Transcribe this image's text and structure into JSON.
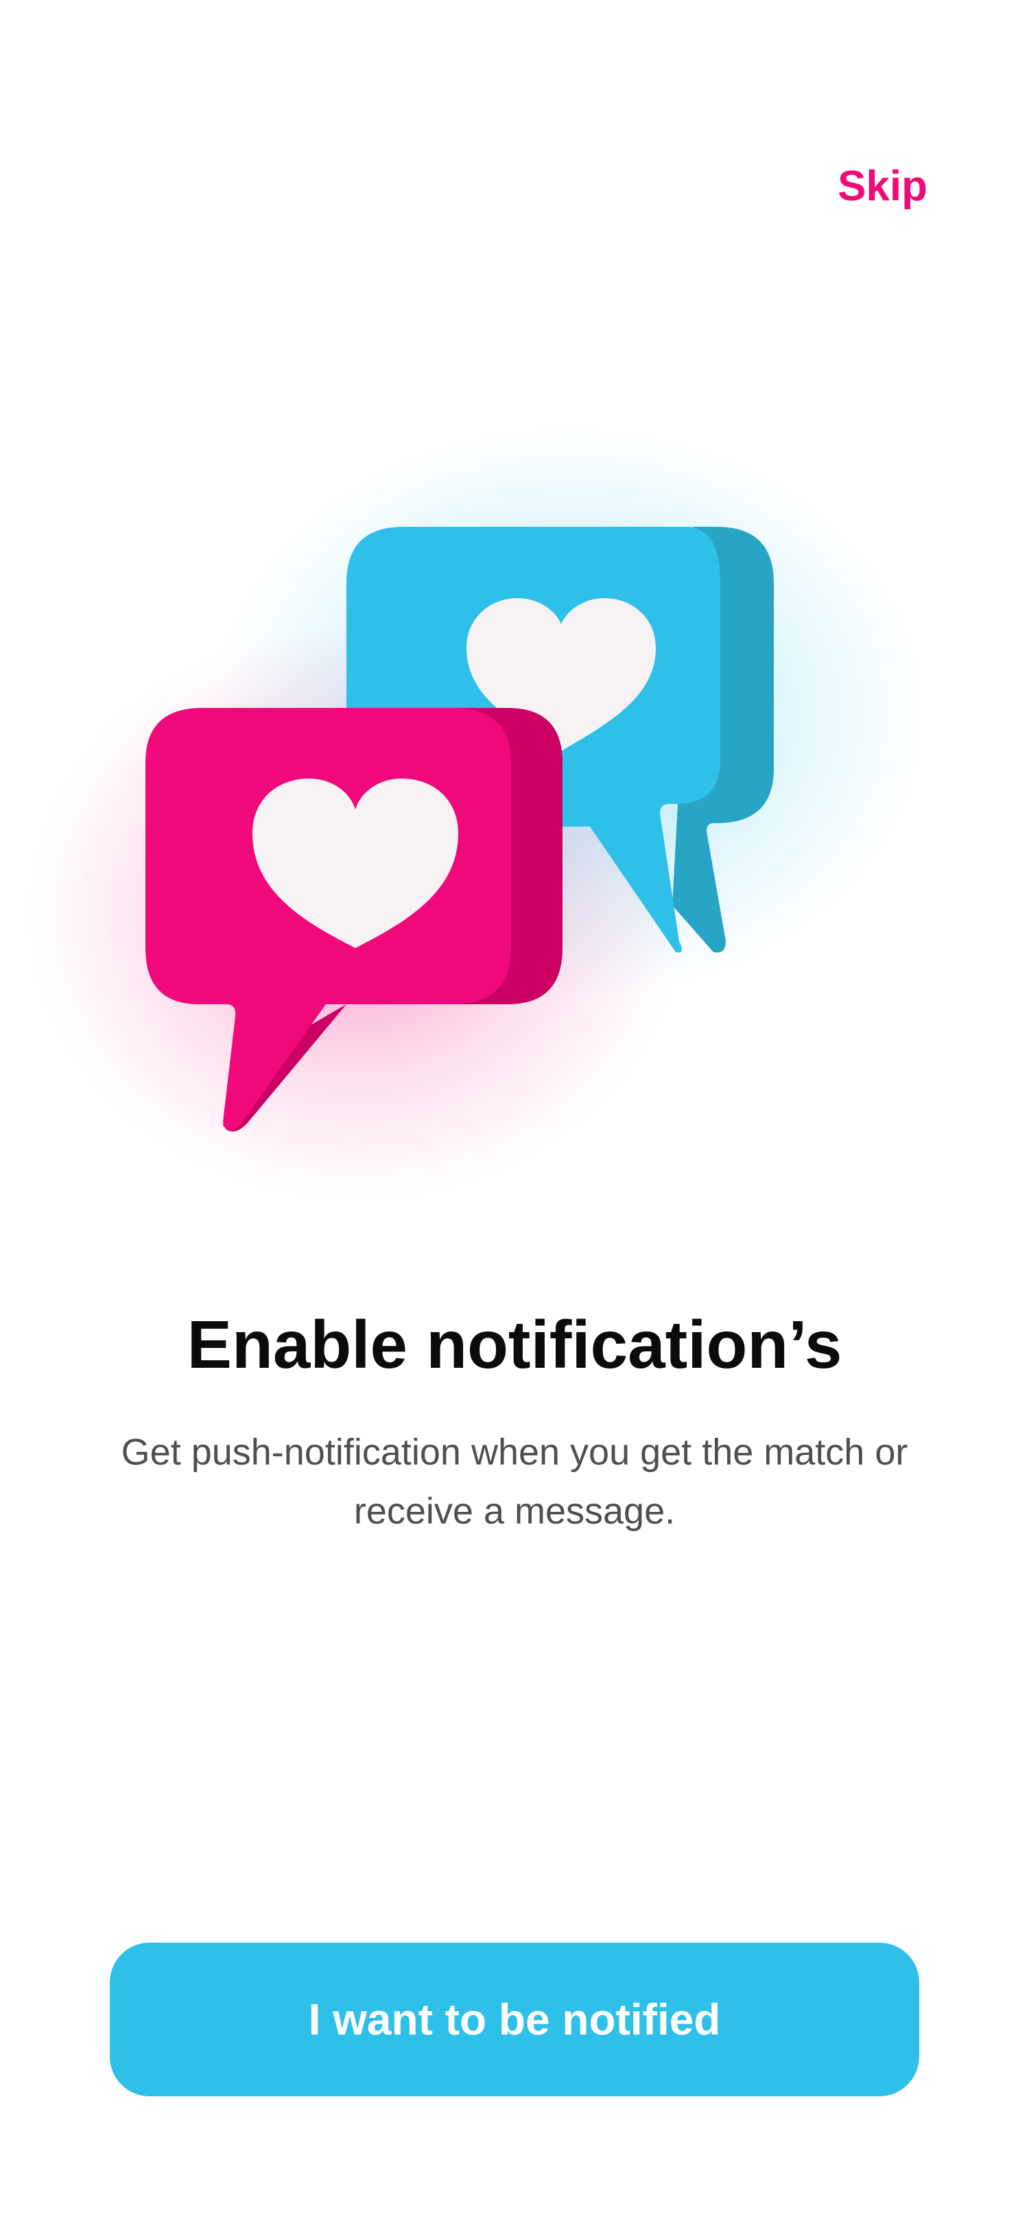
{
  "header": {
    "skip_label": "Skip"
  },
  "illustration": {
    "icon": "chat-bubbles-heart-icon",
    "colors": {
      "pink": "#f0097a",
      "pink_shade": "#cc0064",
      "blue": "#2ec0e9",
      "blue_shade": "#28a4c4",
      "heart": "#f7f3f4"
    }
  },
  "main": {
    "title": "Enable notification’s",
    "subtitle": "Get push-notification when you get the match or receive a message."
  },
  "footer": {
    "cta_label": "I want to be notified",
    "cta_color": "#2ec0e9"
  },
  "colors": {
    "accent": "#ef0a78",
    "background": "#ffffff",
    "title": "#0b0b0b",
    "subtitle": "#4f4f4f"
  }
}
